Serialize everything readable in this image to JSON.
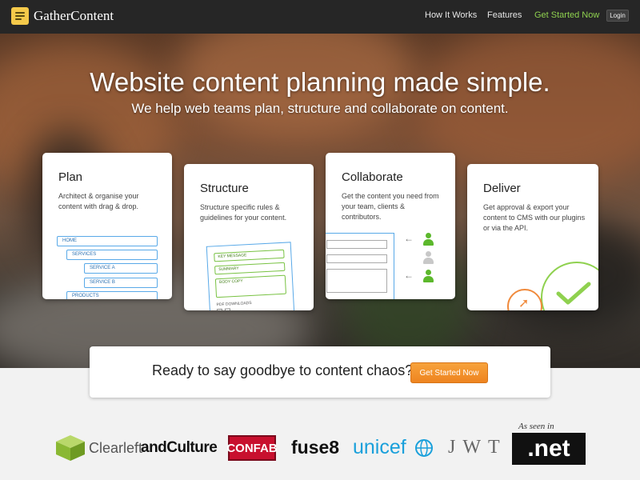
{
  "header": {
    "logo_text": "GatherContent",
    "nav": [
      {
        "label": "How It Works"
      },
      {
        "label": "Features"
      },
      {
        "label": "Get Started Now",
        "accent": "#8fd14f"
      }
    ],
    "login_label": "Login"
  },
  "hero": {
    "title": "Website content planning made simple.",
    "subtitle": "We help web teams plan, structure and collaborate on content."
  },
  "cards": [
    {
      "title": "Plan",
      "description": "Architect & organise your content with drag & drop.",
      "tree": [
        "HOME",
        "SERVICES",
        "SERVICE A",
        "SERVICE B",
        "PRODUCTS"
      ]
    },
    {
      "title": "Structure",
      "description": "Structure specific rules & guidelines for your content.",
      "fields": [
        "KEY MESSAGE",
        "SUMMARY",
        "BODY COPY",
        "PDF DOWNLOADS"
      ]
    },
    {
      "title": "Collaborate",
      "description": "Get the content you need from your team, clients & contributors."
    },
    {
      "title": "Deliver",
      "description": "Get approval & export your content to CMS with our plugins or via the API."
    }
  ],
  "cta": {
    "text": "Ready to say goodbye to content chaos?",
    "button_label": "Get Started Now"
  },
  "logos": {
    "as_seen_in": "As seen in",
    "items": [
      "Clearleft",
      "andCulture",
      "CONFAB",
      "fuse8",
      "unicef",
      "JWT",
      ".net"
    ]
  },
  "colors": {
    "accent_green": "#8fd14f",
    "cta_orange": "#f29330",
    "diagram_blue": "#59a9e8",
    "diagram_green": "#78c242"
  }
}
